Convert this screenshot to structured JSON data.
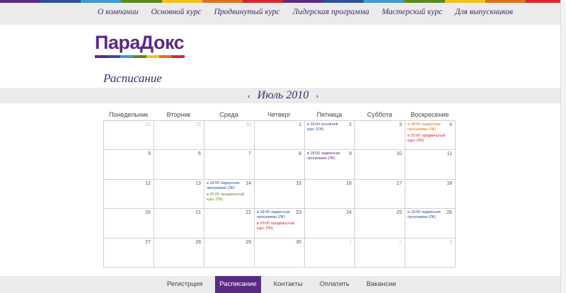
{
  "top_nav": [
    "О компании",
    "Основной курс",
    "Продвинутый курс",
    "Лидерская программа",
    "Мастерский курс",
    "Для выпускников"
  ],
  "logo": {
    "text": "ПараДокс"
  },
  "page_title": "Расписание",
  "calendar": {
    "month": "Июль 2010",
    "prev_icon": "‹",
    "next_icon": "›",
    "weekdays": [
      "Понедельник",
      "Вторник",
      "Среда",
      "Четверг",
      "Пятница",
      "Суббота",
      "Воскресение"
    ],
    "weeks": [
      [
        {
          "day": "28",
          "other": true,
          "events": []
        },
        {
          "day": "29",
          "other": true,
          "events": []
        },
        {
          "day": "30",
          "other": true,
          "events": []
        },
        {
          "day": "1",
          "events": []
        },
        {
          "day": "2",
          "events": [
            {
              "text": "в 18:00 основной курс (ОК)",
              "color": "#2d4f9e"
            }
          ]
        },
        {
          "day": "3",
          "events": []
        },
        {
          "day": "4",
          "events": [
            {
              "text": "в 18:00 лидерская программа (ЛК)",
              "color": "#e0701c"
            },
            {
              "text": "в 20:00 продвинутый курс (ПК)",
              "color": "#d8262c"
            }
          ]
        }
      ],
      [
        {
          "day": "5",
          "events": []
        },
        {
          "day": "6",
          "events": []
        },
        {
          "day": "7",
          "events": []
        },
        {
          "day": "8",
          "events": []
        },
        {
          "day": "9",
          "events": [
            {
              "text": "в 18:00 лидерская программа (ЛК)",
              "color": "#5a2b82"
            }
          ]
        },
        {
          "day": "10",
          "events": []
        },
        {
          "day": "11",
          "events": []
        }
      ],
      [
        {
          "day": "12",
          "events": []
        },
        {
          "day": "13",
          "events": []
        },
        {
          "day": "14",
          "events": [
            {
              "text": "в 18:00 лидерская программа (ЛК)",
              "color": "#2d4f9e"
            },
            {
              "text": "в 20:00 продвинутый курс (ПК)",
              "color": "#5a8a22"
            }
          ]
        },
        {
          "day": "15",
          "events": []
        },
        {
          "day": "16",
          "events": []
        },
        {
          "day": "17",
          "events": []
        },
        {
          "day": "18",
          "events": []
        }
      ],
      [
        {
          "day": "20",
          "events": []
        },
        {
          "day": "21",
          "events": []
        },
        {
          "day": "22",
          "events": []
        },
        {
          "day": "23",
          "events": [
            {
              "text": "в 18:00 лидерская программа (ЛК)",
              "color": "#2d4f9e"
            },
            {
              "text": "в 20:00 продвинутый курс (ПК)",
              "color": "#d8262c"
            }
          ]
        },
        {
          "day": "24",
          "events": []
        },
        {
          "day": "25",
          "events": []
        },
        {
          "day": "26",
          "events": [
            {
              "text": "в 18:00 лидерская программа (ЛК)",
              "color": "#2d4f9e"
            }
          ]
        }
      ],
      [
        {
          "day": "27",
          "events": []
        },
        {
          "day": "28",
          "events": []
        },
        {
          "day": "29",
          "events": []
        },
        {
          "day": "30",
          "events": []
        },
        {
          "day": "1",
          "other": true,
          "events": []
        },
        {
          "day": "2",
          "other": true,
          "events": []
        },
        {
          "day": "3",
          "other": true,
          "events": []
        }
      ]
    ]
  },
  "bottom_nav": [
    {
      "label": "Регистрция",
      "active": false
    },
    {
      "label": "Расписание",
      "active": true
    },
    {
      "label": "Контакты",
      "active": false
    },
    {
      "label": "Оплатить",
      "active": false
    },
    {
      "label": "Вакансии",
      "active": false
    }
  ],
  "colors": {
    "brand": "#5a2b82",
    "stripe": [
      "#5a2b82",
      "#2d4f9e",
      "#3a9bd5",
      "#5a8a22",
      "#f2c21b",
      "#e0701c",
      "#d8262c",
      "#5a2b82",
      "#2d4f9e",
      "#3a9bd5",
      "#5a8a22",
      "#f2c21b",
      "#e0701c",
      "#d8262c"
    ]
  }
}
